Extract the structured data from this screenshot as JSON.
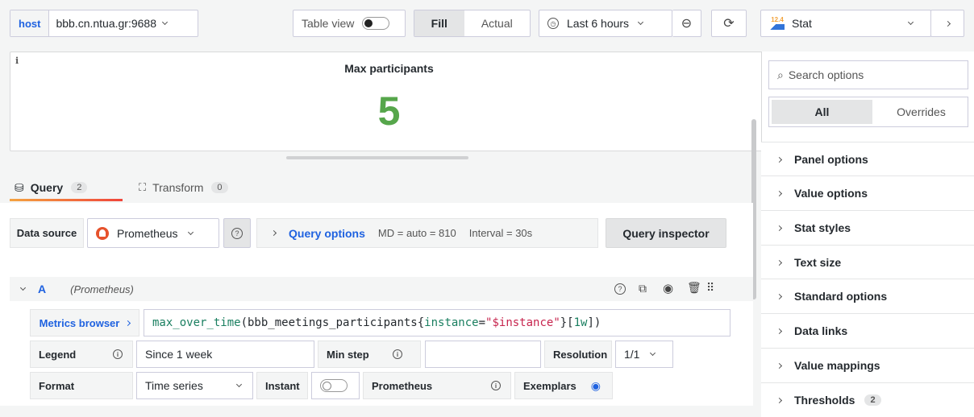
{
  "toolbar": {
    "var_label": "host",
    "var_value": "bbb.cn.ntua.gr:9688",
    "table_view_label": "Table view",
    "fill_label": "Fill",
    "actual_label": "Actual",
    "time_range": "Last 6 hours"
  },
  "viz_picker": {
    "icon_text": "12.4",
    "label": "Stat"
  },
  "panel": {
    "info": "i",
    "title": "Max participants",
    "value": "5",
    "value_color": "#56a64b"
  },
  "tabs": {
    "query_label": "Query",
    "query_count": "2",
    "transform_label": "Transform",
    "transform_count": "0"
  },
  "datasource": {
    "label": "Data source",
    "value": "Prometheus",
    "query_options_label": "Query options",
    "md": "MD = auto = 810",
    "interval": "Interval = 30s",
    "inspector_label": "Query inspector"
  },
  "query": {
    "ref": "A",
    "ds": "(Prometheus)",
    "metrics_browser": "Metrics browser",
    "expr_func": "max_over_time",
    "expr_metric": "(bbb_meetings_participants{",
    "expr_label": "instance",
    "expr_eq": "=",
    "expr_value": "\"$instance\"",
    "expr_tail": "}[",
    "expr_range": "1w",
    "expr_close": "])",
    "legend_label": "Legend",
    "legend_value": "Since 1 week",
    "minstep_label": "Min step",
    "minstep_value": "",
    "resolution_label": "Resolution",
    "resolution_value": "1/1",
    "format_label": "Format",
    "format_value": "Time series",
    "instant_label": "Instant",
    "prometheus_label": "Prometheus",
    "exemplars_label": "Exemplars"
  },
  "options": {
    "search_placeholder": "Search options",
    "all_label": "All",
    "overrides_label": "Overrides",
    "sections": [
      "Panel options",
      "Value options",
      "Stat styles",
      "Text size",
      "Standard options",
      "Data links",
      "Value mappings",
      "Thresholds"
    ],
    "thresholds_count": "2"
  },
  "colors": {
    "accent": "#1f62e0",
    "tab_underline": "#f0453a",
    "value_green": "#56a64b"
  }
}
